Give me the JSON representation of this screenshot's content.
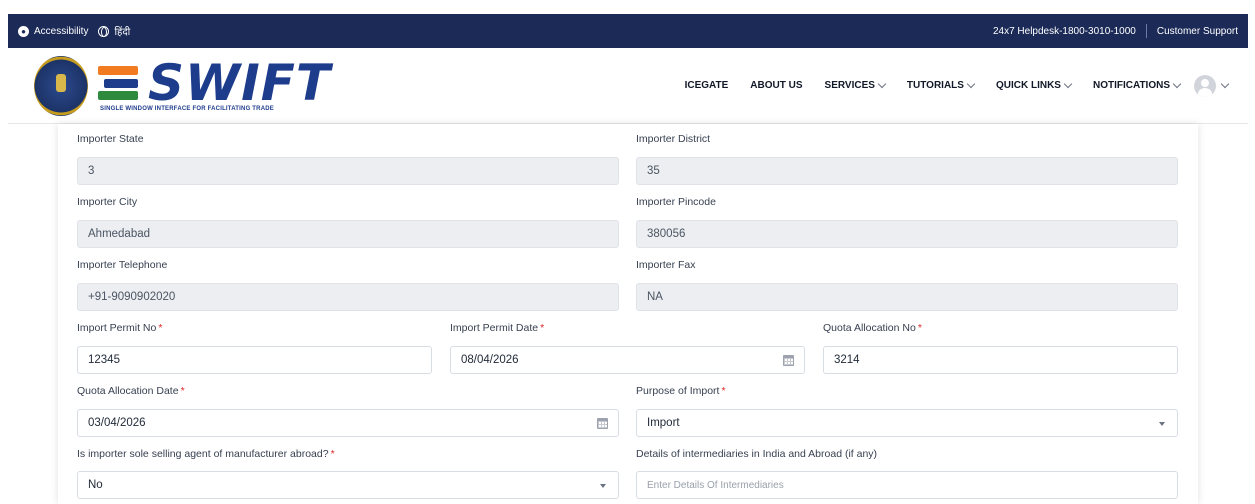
{
  "topbar": {
    "accessibility": "Accessibility",
    "language": "हिंदी",
    "helpdesk": "24x7 Helpdesk-1800-3010-1000",
    "support": "Customer Support"
  },
  "header": {
    "logo_word": "SWIFT",
    "logo_tagline": "SINGLE WINDOW INTERFACE FOR FACILITATING TRADE",
    "nav": [
      {
        "label": "ICEGATE",
        "dropdown": false
      },
      {
        "label": "ABOUT US",
        "dropdown": false
      },
      {
        "label": "SERVICES",
        "dropdown": true
      },
      {
        "label": "TUTORIALS",
        "dropdown": true
      },
      {
        "label": "QUICK LINKS",
        "dropdown": true
      },
      {
        "label": "NOTIFICATIONS",
        "dropdown": true
      }
    ]
  },
  "form": {
    "importer_state": {
      "label": "Importer State",
      "value": "3"
    },
    "importer_district": {
      "label": "Importer District",
      "value": "35"
    },
    "importer_city": {
      "label": "Importer City",
      "value": "Ahmedabad"
    },
    "importer_pincode": {
      "label": "Importer Pincode",
      "value": "380056"
    },
    "importer_telephone": {
      "label": "Importer Telephone",
      "value": "+91-9090902020"
    },
    "importer_fax": {
      "label": "Importer Fax",
      "value": "NA"
    },
    "import_permit_no": {
      "label": "Import Permit No",
      "value": "12345"
    },
    "import_permit_date": {
      "label": "Import Permit Date",
      "value": "08/04/2026"
    },
    "quota_allocation_no": {
      "label": "Quota Allocation No",
      "value": "3214"
    },
    "quota_allocation_date": {
      "label": "Quota Allocation Date",
      "value": "03/04/2026"
    },
    "purpose_of_import": {
      "label": "Purpose of Import",
      "value": "Import"
    },
    "sole_selling_agent": {
      "label": "Is importer sole selling agent of manufacturer abroad?",
      "value": "No"
    },
    "intermediaries": {
      "label": "Details of intermediaries in India and Abroad (if any)",
      "placeholder": "Enter Details Of Intermediaries"
    }
  },
  "required_marker": "*",
  "colors": {
    "topbar": "#1b2a57",
    "brand_blue": "#1e3c8c",
    "required": "#dc2626",
    "readonly_bg": "#eceef1"
  },
  "icons": [
    "accessibility-icon",
    "globe-icon",
    "chevron-down-icon",
    "avatar-icon",
    "calendar-icon",
    "caret-down-icon"
  ]
}
